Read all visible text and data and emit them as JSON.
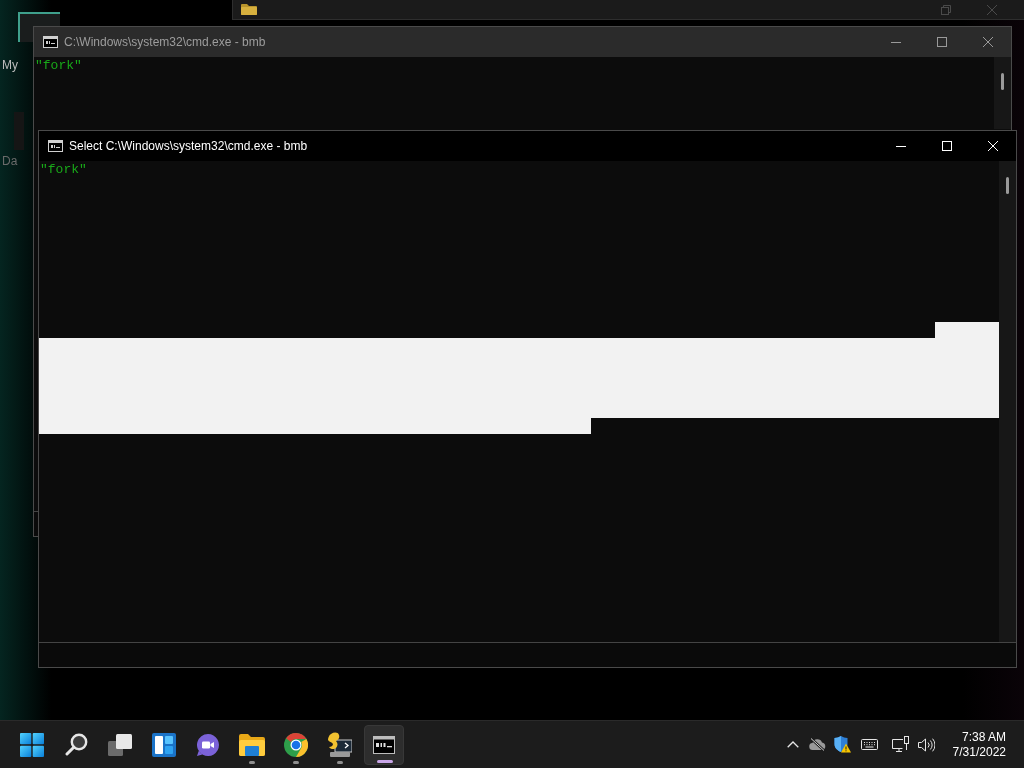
{
  "desktop": {
    "icons": [
      {
        "label": "My"
      },
      {
        "label": "Da"
      }
    ]
  },
  "windows": [
    {
      "title": "C:\\Windows\\system32\\cmd.exe - bmb",
      "focused": false,
      "selection": false,
      "lines": [
        "\"fork\""
      ]
    },
    {
      "title": "Select C:\\Windows\\system32\\cmd.exe - bmb",
      "focused": true,
      "selection": true,
      "lines": [
        "\"fork\""
      ]
    }
  ],
  "taskbar": {
    "apps": [
      {
        "kind": "start",
        "running": false,
        "selected": false
      },
      {
        "kind": "search",
        "running": false,
        "selected": false
      },
      {
        "kind": "task_view",
        "running": false,
        "selected": false
      },
      {
        "kind": "widgets",
        "running": false,
        "selected": false
      },
      {
        "kind": "chat",
        "running": false,
        "selected": false
      },
      {
        "kind": "files",
        "running": true,
        "selected": false
      },
      {
        "kind": "browser",
        "running": true,
        "selected": false
      },
      {
        "kind": "script",
        "running": true,
        "selected": false
      },
      {
        "kind": "console",
        "running": true,
        "selected": true
      }
    ],
    "tray": {
      "time": "7:38 AM",
      "date": "7/31/2022"
    }
  }
}
